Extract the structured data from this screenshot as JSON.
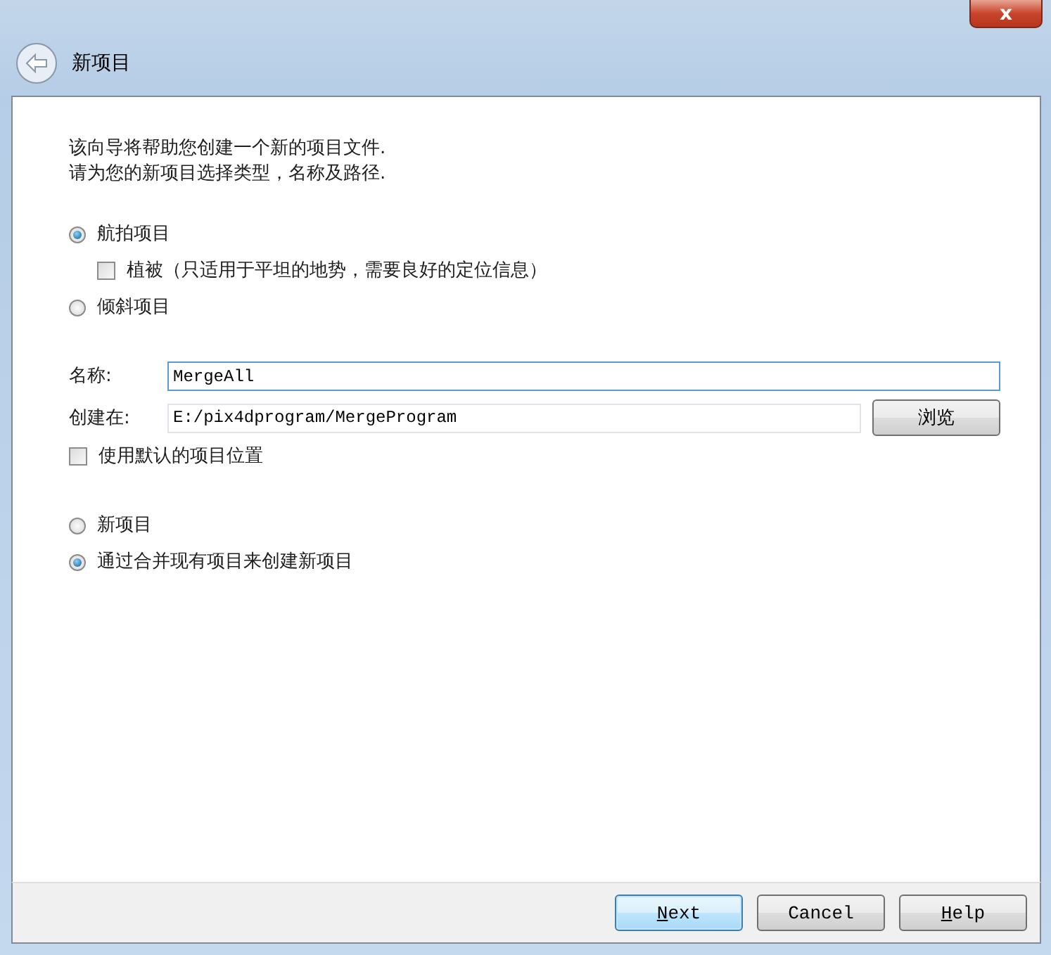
{
  "window": {
    "title": "新项目",
    "close_button": "x"
  },
  "intro": [
    "该向导将帮助您创建一个新的项目文件.",
    "请为您的新项目选择类型，名称及路径."
  ],
  "project_types": [
    {
      "label": "航拍项目",
      "selected": true,
      "sub_option": {
        "label": "植被（只适用于平坦的地势，需要良好的定位信息）",
        "checked": false
      }
    },
    {
      "label": "倾斜项目",
      "selected": false
    }
  ],
  "name_field": {
    "label": "名称:",
    "value": "MergeAll"
  },
  "location_field": {
    "label": "创建在:",
    "value": "E:/pix4dprogram/MergeProgram",
    "browse_button": "浏览"
  },
  "use_default_location": {
    "label": "使用默认的项目位置",
    "checked": false
  },
  "creation_modes": [
    {
      "label": "新项目",
      "selected": false
    },
    {
      "label": "通过合并现有项目来创建新项目",
      "selected": true
    }
  ],
  "buttons": [
    {
      "mnemonic": "N",
      "rest": "ext",
      "default": true
    },
    {
      "rest": "Cancel",
      "default": false
    },
    {
      "mnemonic": "H",
      "rest": "elp",
      "default": false
    }
  ]
}
